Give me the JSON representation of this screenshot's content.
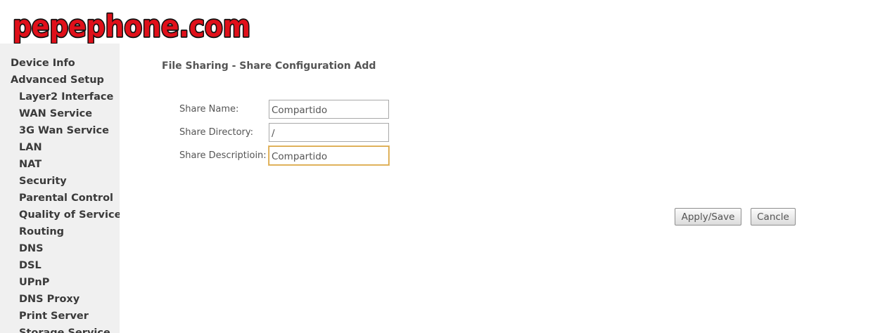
{
  "brand": {
    "logo_text": "pepephone.com",
    "logo_fill_color": "#e0101a",
    "logo_outline_color": "#111111"
  },
  "sidebar": {
    "background_color": "#f0f0f0",
    "items": [
      {
        "label": "Device Info",
        "level": 0
      },
      {
        "label": "Advanced Setup",
        "level": 0
      },
      {
        "label": "Layer2 Interface",
        "level": 1
      },
      {
        "label": "WAN Service",
        "level": 1
      },
      {
        "label": "3G Wan Service",
        "level": 1
      },
      {
        "label": "LAN",
        "level": 1
      },
      {
        "label": "NAT",
        "level": 1
      },
      {
        "label": "Security",
        "level": 1
      },
      {
        "label": "Parental Control",
        "level": 1
      },
      {
        "label": "Quality of Service",
        "level": 1
      },
      {
        "label": "Routing",
        "level": 1
      },
      {
        "label": "DNS",
        "level": 1
      },
      {
        "label": "DSL",
        "level": 1
      },
      {
        "label": "UPnP",
        "level": 1
      },
      {
        "label": "DNS Proxy",
        "level": 1
      },
      {
        "label": "Print Server",
        "level": 1
      },
      {
        "label": "Storage Service",
        "level": 1
      }
    ]
  },
  "main": {
    "title": "File Sharing - Share Configuration Add",
    "fields": {
      "share_name": {
        "label": "Share Name:",
        "value": "Compartido"
      },
      "share_directory": {
        "label": "Share Directory:",
        "value": "/"
      },
      "share_description": {
        "label": "Share Descriptioin:",
        "value": "Compartido"
      }
    },
    "buttons": {
      "apply_label": "Apply/Save",
      "cancel_label": "Cancle"
    }
  },
  "colors": {
    "focus_border": "#d9a441",
    "text": "#555555"
  }
}
